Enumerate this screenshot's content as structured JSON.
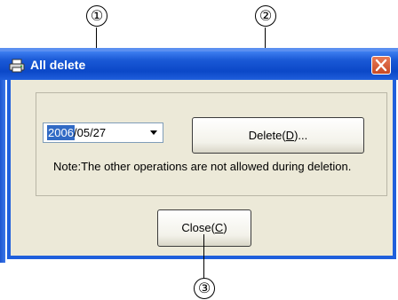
{
  "window": {
    "title": "All delete",
    "close_glyph": "✕",
    "title_icon": "printer-icon"
  },
  "date_field": {
    "selected_part": "2006",
    "rest": "/05/27",
    "dropdown_icon": "chevron-down-icon"
  },
  "buttons": {
    "delete": {
      "text": "Delete(",
      "mnemonic": "D",
      "suffix": ")..."
    },
    "close": {
      "text": "Close(",
      "mnemonic": "C",
      "suffix": ")"
    }
  },
  "note": "Note:The other operations are not allowed during deletion.",
  "callouts": [
    "①",
    "②",
    "③"
  ]
}
